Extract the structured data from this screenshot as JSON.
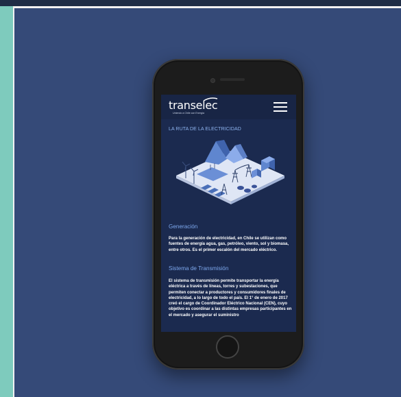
{
  "app": {
    "logo_text": "transelec",
    "logo_tagline": "Uniendo a Chile con Energía"
  },
  "page": {
    "section_title": "LA RUTA DE LA ELECTRICIDAD"
  },
  "sections": [
    {
      "heading": "Generación",
      "body": "Para la generación de electricidad, en Chile se utilizan como fuentes de energía agua, gas, petróleo, viento, sol y biomasa, entre otros. Es el primer escalón del mercado eléctrico."
    },
    {
      "heading": "Sistema de Transmisión",
      "body": "El sistema de transmisión permite transportar la energía eléctrica a través de líneas, torres y subestaciones, que permiten conectar a productores y consumidores finales de electricidad, a lo largo de todo el país. El 1° de enero de 2017 creó el cargo de Coordinador Eléctrico Nacional (CEN), cuyo objetivo es coordinar a las distintas empresas participantes en el mercado y asegurar el suministro"
    }
  ],
  "colors": {
    "stage": "#354a78",
    "accent_strip": "#7ecbbd",
    "screen_bg": "#1b2a4f",
    "heading": "#7da8ee",
    "section_title": "#8fb5f0"
  },
  "icons": {
    "menu": "hamburger-menu-icon"
  }
}
